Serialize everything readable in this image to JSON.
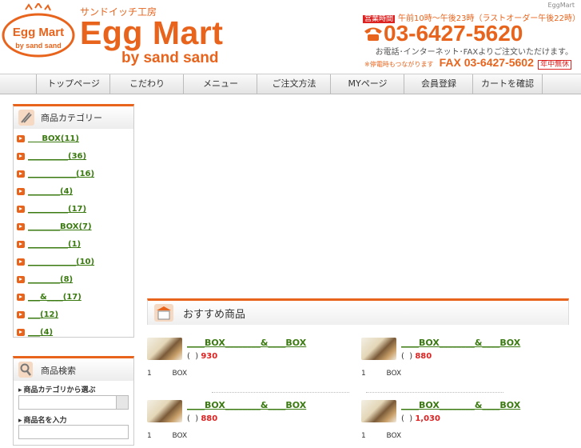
{
  "header": {
    "top_right": "EggMart",
    "logo_line1": "Egg Mart",
    "logo_line2": "by sand sand",
    "tagline": "サンドイッチ工房",
    "brand": "Egg Mart",
    "brand_sub": "by sand sand",
    "hours_badge": "営業時間",
    "hours_text": "午前10時～午後23時（ラストオーダー午後22時）",
    "phone": "03-6427-5620",
    "contact_note": "お電話･インターネット･FAXよりご注文いただけます。",
    "power_note": "※停電時もつながります",
    "fax": "FAX 03-6427-5602",
    "open_badge": "年中無休"
  },
  "nav": {
    "items": [
      "トップページ",
      "こだわり",
      "メニュー",
      "ご注文方法",
      "MYページ",
      "会員登録",
      "カートを確認"
    ]
  },
  "sidebar": {
    "category_title": "商品カテゴリー",
    "categories": [
      "     BOX(11)",
      "__________(36)",
      "____________(16)",
      "________(4)",
      "__________(17)",
      "________BOX(7)",
      "__________(1)",
      "____________(10)",
      "________(8)",
      "___&____(17)",
      "___(12)",
      "___(4)"
    ],
    "search_title": "商品検索",
    "search_category_label": "商品カテゴリから選ぶ",
    "search_name_label": "商品名を入力"
  },
  "main": {
    "recommend_title": "おすすめ商品",
    "products": [
      {
        "name": "____BOX________&____BOX",
        "price_open": "(  ) ",
        "price": "930",
        "desc": "1         BOX"
      },
      {
        "name": "____BOX________&____BOX",
        "price_open": "(  ) ",
        "price": "880",
        "desc": "1         BOX"
      },
      {
        "name": "____BOX________&____BOX",
        "price_open": "(  ) ",
        "price": "880",
        "desc": "1         BOX"
      },
      {
        "name": "____BOX________&____BOX",
        "price_open": "(  ) ",
        "price": "1,030",
        "desc": "1         BOX"
      }
    ]
  },
  "colors": {
    "accent": "#e8641d",
    "link": "#3a7a10",
    "price": "#dd2222"
  }
}
